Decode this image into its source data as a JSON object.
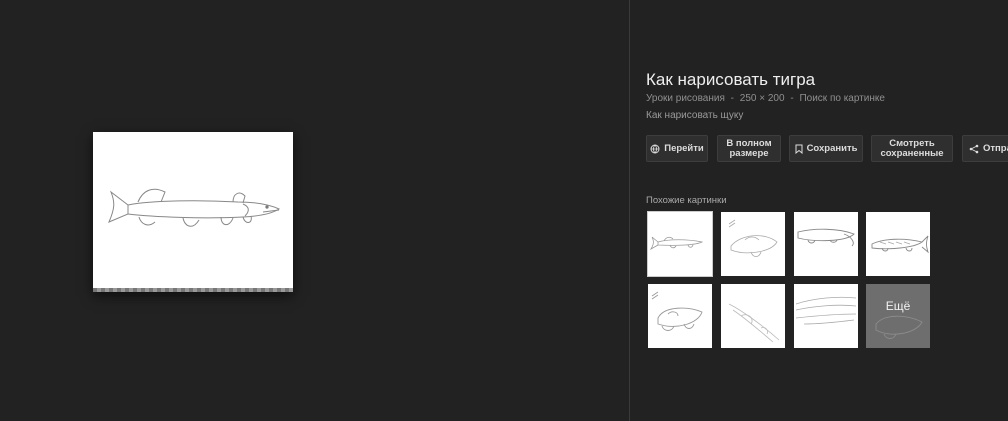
{
  "panel": {
    "title": "Как нарисовать тигра",
    "meta": {
      "source": "Уроки рисования",
      "sep1": "-",
      "dimensions": "250 × 200",
      "sep2": "-",
      "search_by_image": "Поиск по картинке"
    },
    "subtitle": "Как нарисовать щуку"
  },
  "actions": {
    "visit": "Перейти",
    "full_size": "В полном размере",
    "save": "Сохранить",
    "view_saved": "Смотреть сохраненные",
    "share": "Отпра"
  },
  "similar": {
    "label": "Похожие картинки",
    "more_label": "Ещё"
  },
  "icons": {
    "visit": "globe-icon",
    "save": "bookmark-icon",
    "share": "share-icon"
  },
  "colors": {
    "background": "#222222",
    "button": "#2f2f2f",
    "title": "#eeeeee",
    "meta": "#8f8f8f"
  }
}
